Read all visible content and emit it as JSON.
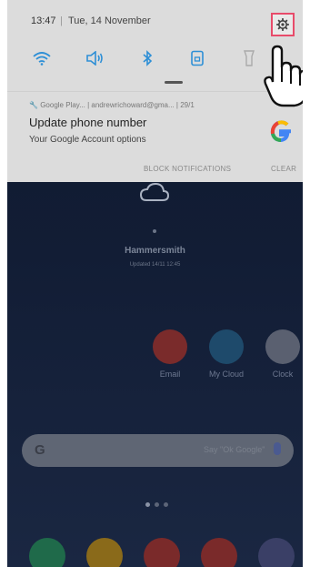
{
  "status_bar": {
    "time": "13:47",
    "separator": "|",
    "date": "Tue, 14 November"
  },
  "quick_toggles": [
    "wifi-icon",
    "sound-icon",
    "bluetooth-icon",
    "rotation-lock-icon",
    "flashlight-icon"
  ],
  "notification": {
    "app": "Google Play...",
    "account": "andrewrichoward@gma...",
    "time": "29/1",
    "title": "Update phone number",
    "subtitle": "Your Google Account options",
    "block_label": "BLOCK NOTIFICATIONS",
    "clear_label": "CLEAR"
  },
  "weather": {
    "city": "Hammersmith",
    "updated": "Updated 14/11 12:45"
  },
  "apps": [
    {
      "label": "Email",
      "color": "#7a2b2b"
    },
    {
      "label": "My Cloud",
      "color": "#1e4a6b"
    },
    {
      "label": "Clock",
      "color": "#5a6070"
    }
  ],
  "search": {
    "logo": "G",
    "placeholder": "Say \"Ok Google\""
  },
  "dock": [
    {
      "name": "phone-icon",
      "color": "#1f6a4a"
    },
    {
      "name": "messages-icon",
      "color": "#8a6a1a"
    },
    {
      "name": "chrome-icon",
      "color": "#7a2a2a"
    },
    {
      "name": "gmail-icon",
      "color": "#7a2a2a"
    },
    {
      "name": "camera-icon",
      "color": "#3a3f66"
    }
  ],
  "colors": {
    "highlight": "#e84b6a",
    "shade_bg": "#dcdcdc",
    "toggle_active": "#2d8fd6"
  }
}
